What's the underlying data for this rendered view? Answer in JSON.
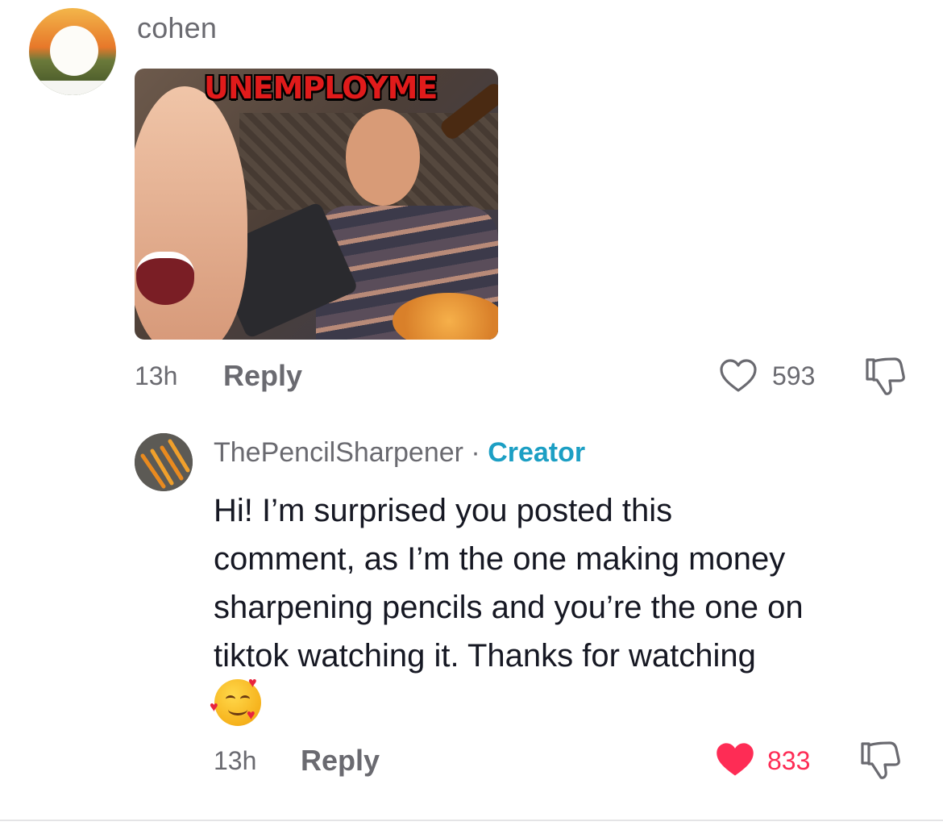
{
  "comments": [
    {
      "username": "cohen",
      "image_banner_text": "UNEMPLOYME",
      "time": "13h",
      "reply_label": "Reply",
      "likes": "593",
      "liked": false
    },
    {
      "username": "ThePencilSharpener",
      "separator": "·",
      "badge": "Creator",
      "text_lines": [
        "Hi! I’m surprised you posted this",
        "comment, as I’m the one making money",
        "sharpening pencils and you’re the one on",
        "tiktok watching it. Thanks for watching"
      ],
      "emoji": "smiling-face-with-hearts",
      "time": "13h",
      "reply_label": "Reply",
      "likes": "833",
      "liked": true
    }
  ],
  "colors": {
    "like_active": "#fe2c55",
    "creator_badge": "#1c9fc4",
    "muted_text": "#6a6a70"
  },
  "icons": {
    "like": "heart-outline-icon",
    "liked": "heart-filled-icon",
    "dislike": "thumbs-down-icon"
  }
}
